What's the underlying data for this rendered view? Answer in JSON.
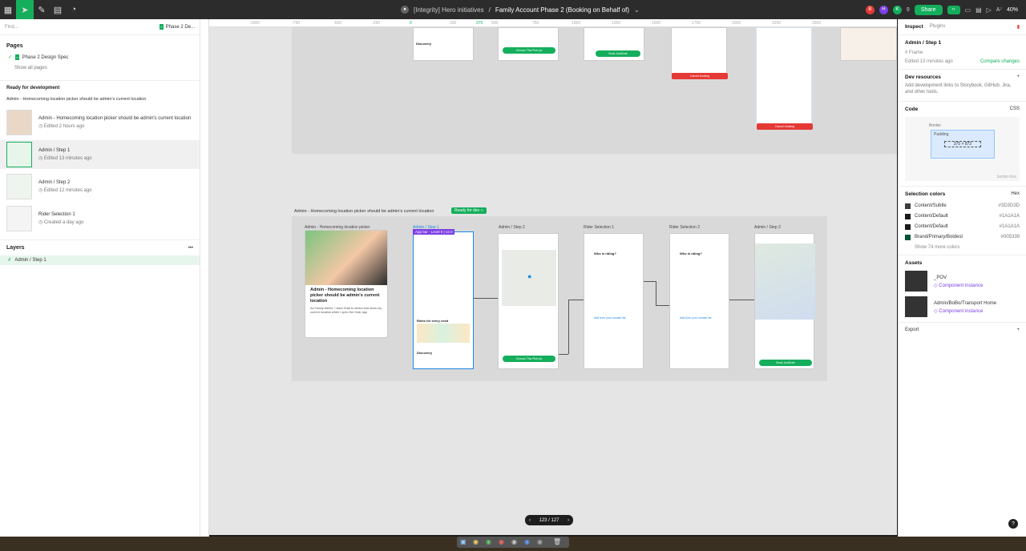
{
  "toolbar": {
    "title_prefix": "[Integrity] Hero initiatives",
    "separator": "/",
    "file_name": "Family Account Phase 2 (Booking on Behalf of)",
    "share": "Share",
    "zoom": "40%",
    "avatars": [
      "B",
      "H",
      "K"
    ],
    "avatar_colors": [
      "#e53935",
      "#7b3fe4",
      "#14ae5c"
    ],
    "viewer_count": "9"
  },
  "left": {
    "find_placeholder": "Find...",
    "page_chip": "Phase 2 De...",
    "pages_label": "Pages",
    "current_page": "Phase 2 Design Spec",
    "show_all": "Show all pages",
    "ready_label": "Ready for development",
    "group_title": "Admin - Homecoming location picker should be admin's current location",
    "items": [
      {
        "title": "Admin - Homecoming location picker should be admin's current location",
        "sub": "Edited 2 hours ago"
      },
      {
        "title": "Admin / Step 1",
        "sub": "Edited 13 minutes ago"
      },
      {
        "title": "Admin / Step 2",
        "sub": "Edited 12 minutes ago"
      },
      {
        "title": "Rider Selection 1",
        "sub": "Created a day ago"
      }
    ],
    "layers_label": "Layers",
    "layer": "Admin / Step 1"
  },
  "ruler": {
    "ticks": [
      "-1000",
      "-750",
      "-500",
      "-250",
      "0",
      "250",
      "375",
      "500",
      "750",
      "1000",
      "1250",
      "1500",
      "1750",
      "2000",
      "2250",
      "2500"
    ]
  },
  "canvas": {
    "section_title": "Admin - Homecoming location picker should be admin's current location",
    "ready_badge": "Ready for dev",
    "frames": [
      "Admin - Homecoming location picker",
      "Admin / Step 1",
      "Admin / Step 2",
      "Rider Selection 1",
      "Rider Selection 2",
      "Admin / Step 3"
    ],
    "selection_tag": "App bar - Level 0 | v2.0",
    "cover_title": "Admin - Homecoming location picker should be admin's current location",
    "cover_desc": "As Family Admin, I want Grab to detect and show my current location when I open the Grab app",
    "btn_choose": "Choose This Pick-Up",
    "btn_book": "Book JustGrab",
    "btn_cancel": "Cancel booking",
    "who_riding": "Who is riding?",
    "add_contact": "Add from your contact list",
    "discovery": "Discovery",
    "rides": "Rides for every need"
  },
  "pagination": {
    "label": "123 / 127"
  },
  "inspect": {
    "tabs": [
      "Inspect",
      "Plugins"
    ],
    "frame_name": "Admin / Step 1",
    "frame_type": "Frame",
    "edited": "Edited 13 minutes ago",
    "compare": "Compare changes",
    "dev_title": "Dev resources",
    "dev_desc": "Add development links to Storybook, GitHub, Jira, and other tools.",
    "code": "Code",
    "css": "CSS",
    "border": "Border",
    "padding": "Padding",
    "size": "375 × 872",
    "boxsizing": "border-box",
    "sel_colors": "Selection colors",
    "hex": "Hex",
    "colors": [
      {
        "name": "Content/Subtle",
        "hex": "#3D3D3D",
        "c": "#3D3D3D"
      },
      {
        "name": "Content/Default",
        "hex": "#1A1A1A",
        "c": "#1A1A1A"
      },
      {
        "name": "Content/Default",
        "hex": "#1A1A1A",
        "c": "#1A1A1A"
      },
      {
        "name": "Brand/Primary/Boldest",
        "hex": "#005339",
        "c": "#005339"
      }
    ],
    "show_more": "Show 74 more colors",
    "assets": "Assets",
    "asset_items": [
      {
        "name": "_POV",
        "type": "Component instance"
      },
      {
        "name": "Admin/BoBo/Transport Home",
        "type": "Component instance"
      }
    ],
    "export": "Export"
  }
}
